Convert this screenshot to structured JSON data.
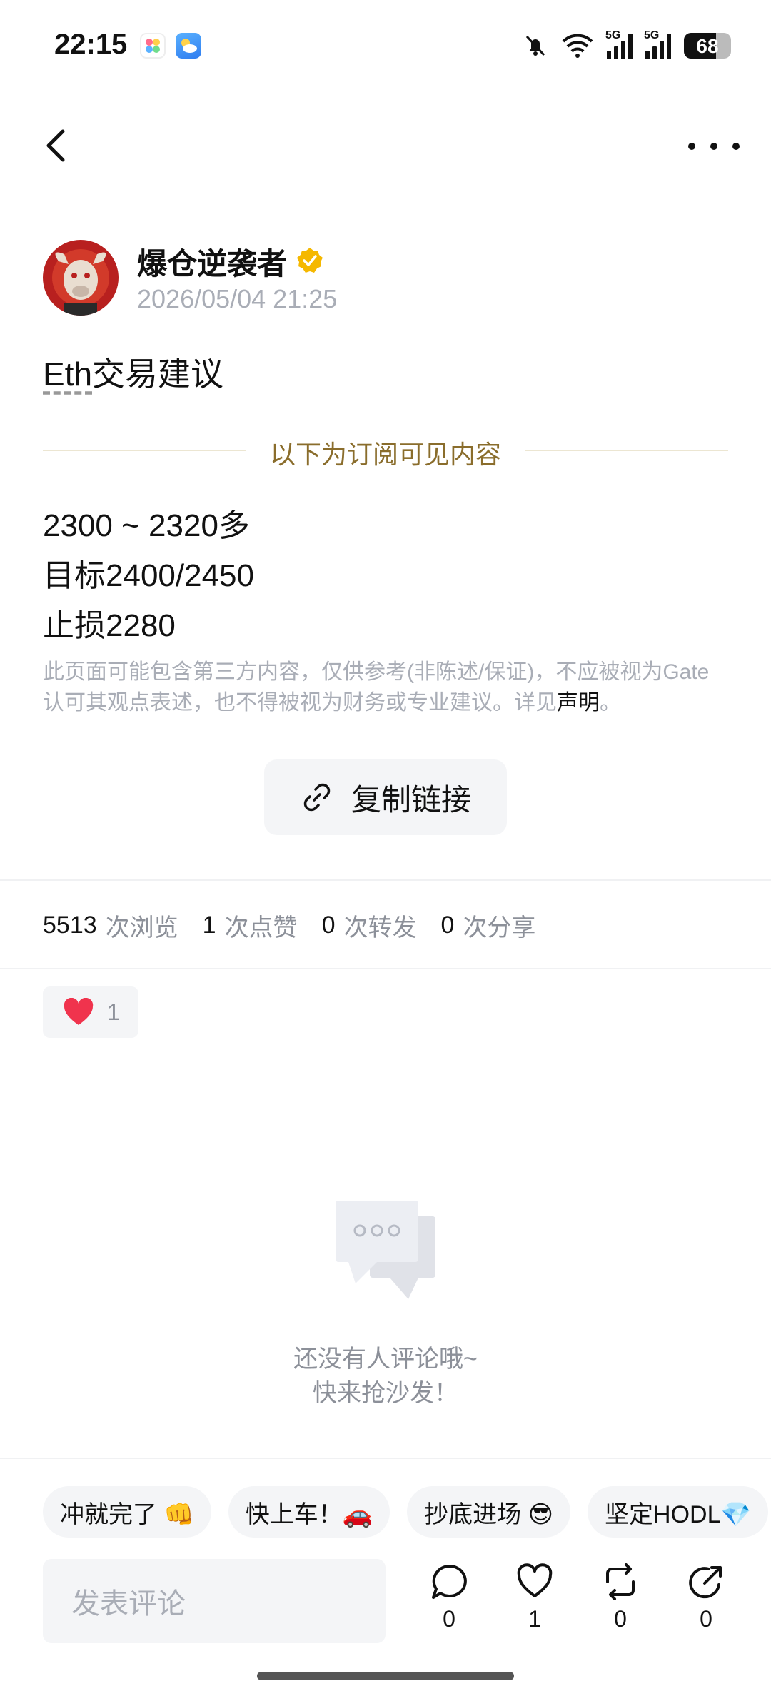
{
  "status_bar": {
    "time": "22:15",
    "signal1_label": "5G",
    "signal2_label": "5G",
    "battery": "68",
    "battery_fraction": 0.68
  },
  "post": {
    "author": "爆仓逆袭者",
    "datetime": "2026/05/04 21:25",
    "title_underlined": "Eth",
    "title_rest": "交易建议",
    "subscriber_divider": "以下为订阅可见内容",
    "content_lines": [
      "2300 ~ 2320多",
      "目标2400/2450",
      "止损2280"
    ],
    "disclaimer": "此页面可能包含第三方内容，仅供参考(非陈述/保证)，不应被视为Gate认可其观点表述，也不得被视为财务或专业建议。详见",
    "disclaimer_link": "声明",
    "disclaimer_end": "。",
    "copy_link_label": "复制链接"
  },
  "stats": {
    "views": "5513",
    "views_unit": "次浏览",
    "likes": "1",
    "likes_unit": "次点赞",
    "reposts": "0",
    "reposts_unit": "次转发",
    "shares": "0",
    "shares_unit": "次分享"
  },
  "reaction": {
    "emoji": "heart-icon",
    "count": "1"
  },
  "empty_state": {
    "line1": "还没有人评论哦~",
    "line2": "快来抢沙发！"
  },
  "quick_replies": [
    "冲就完了 👊",
    "快上车！🚗",
    "抄底进场 😎",
    "坚定HODL💎"
  ],
  "comment_bar": {
    "placeholder": "发表评论",
    "comment_count": "0",
    "like_count": "1",
    "repost_count": "0",
    "share_count": "0"
  },
  "colors": {
    "accent_gold": "#8a6d2c",
    "verified_badge": "#f5b800",
    "heart": "#f0334d"
  }
}
